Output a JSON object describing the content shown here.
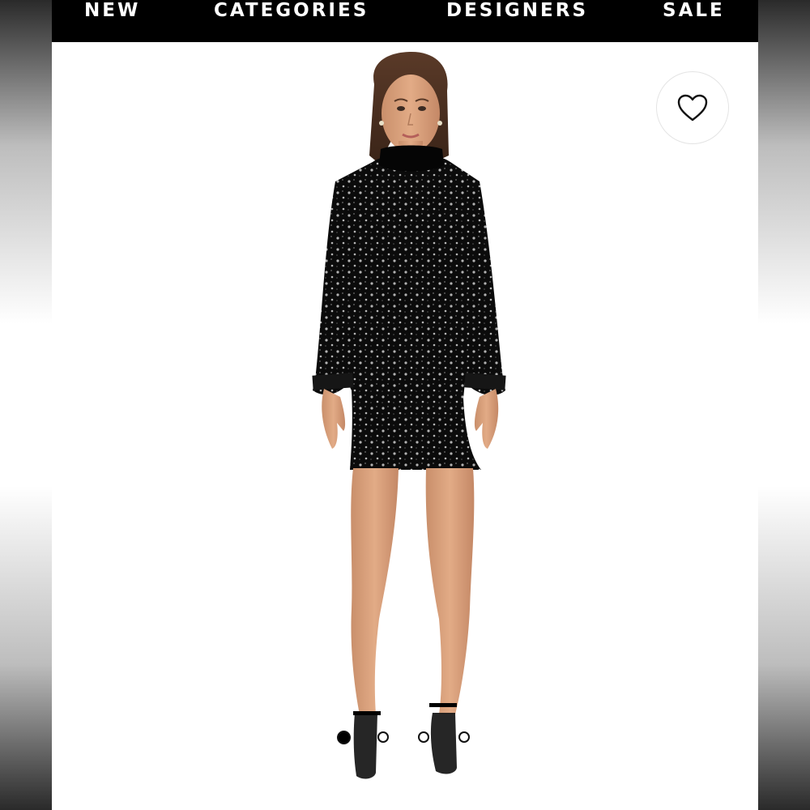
{
  "nav": {
    "items": [
      {
        "label": "NEW"
      },
      {
        "label": "CATEGORIES"
      },
      {
        "label": "DESIGNERS"
      },
      {
        "label": "SALE"
      }
    ],
    "background": "#000000",
    "text_color": "#ffffff"
  },
  "product": {
    "image": "black-sequin-mock-neck-long-sleeve-mini-dress-on-model",
    "wishlist_icon": "heart-outline-icon",
    "carousel": {
      "total": 4,
      "active": 1
    }
  }
}
